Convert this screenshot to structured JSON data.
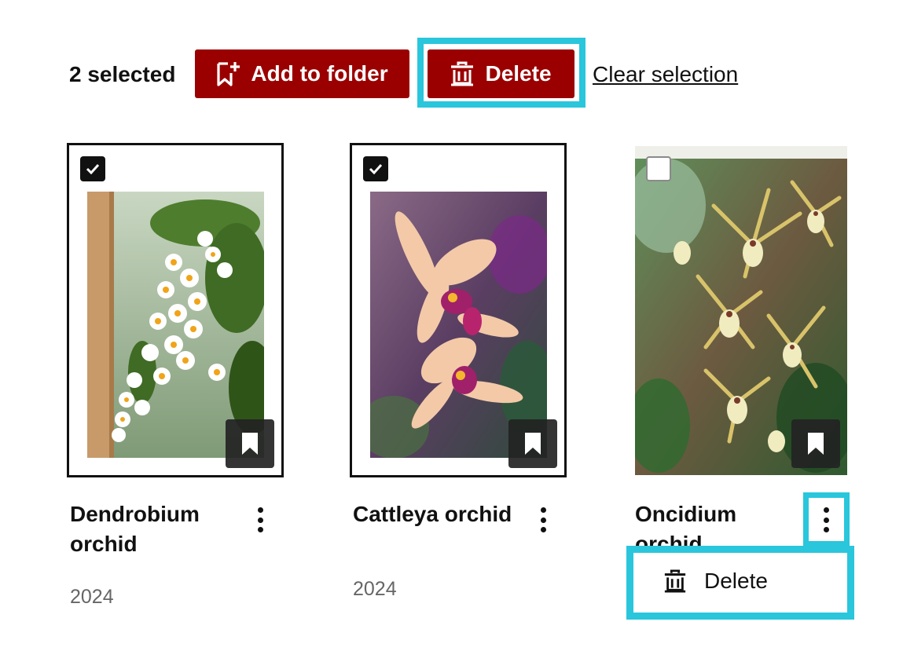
{
  "toolbar": {
    "selected_count": "2 selected",
    "add_label": "Add to folder",
    "delete_label": "Delete",
    "clear_label": "Clear selection"
  },
  "cards": [
    {
      "title": "Dendrobium orchid",
      "year": "2024",
      "selected": true
    },
    {
      "title": "Cattleya orchid",
      "year": "2024",
      "selected": true
    },
    {
      "title": "Oncidium orchid",
      "year": "",
      "selected": false
    }
  ],
  "context_menu": {
    "items": [
      {
        "label": "Delete",
        "icon": "trash-icon"
      }
    ]
  },
  "colors": {
    "accent": "#9b0000",
    "highlight": "#29c6dc",
    "text": "#111111",
    "muted": "#666666"
  }
}
